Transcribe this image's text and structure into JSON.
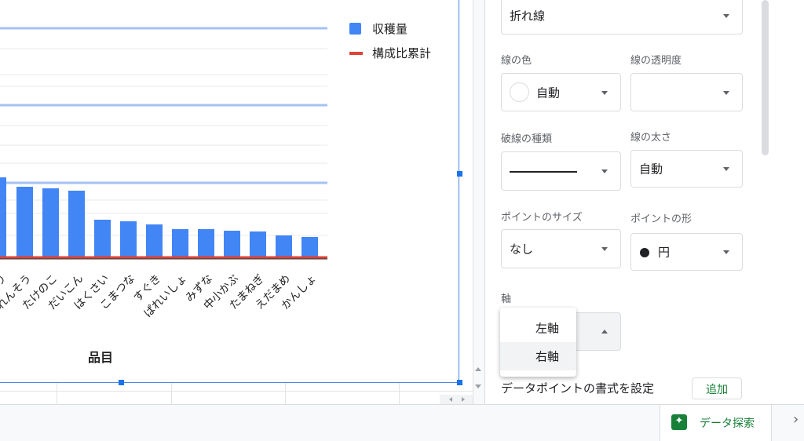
{
  "chart": {
    "legend": [
      {
        "label": "収穫量",
        "kind": "bar",
        "color": "#4285f4"
      },
      {
        "label": "構成比累計",
        "kind": "line",
        "color": "#db4437"
      }
    ],
    "xaxis_title": "品目"
  },
  "chart_data": {
    "type": "bar",
    "title": "",
    "xlabel": "品目",
    "ylabel": "",
    "categories": [
      "ほうれんそう",
      "たけのこ",
      "だいこん",
      "はくさい",
      "こまつな",
      "すぐき",
      "ぱれいしょ",
      "みずな",
      "中小かぶ",
      "たまねぎ",
      "えだまめ",
      "かんしょ"
    ],
    "series": [
      {
        "name": "収穫量",
        "values": [
          92,
          90,
          87,
          50,
          48,
          44,
          38,
          38,
          36,
          35,
          30,
          28
        ]
      }
    ],
    "partial_labels": [
      "り"
    ],
    "legend_position": "top-right"
  },
  "panel": {
    "chart_type_value": "折れ線",
    "line_color_label": "線の色",
    "line_color_value": "自動",
    "line_opacity_label": "線の透明度",
    "line_opacity_value": "",
    "dash_type_label": "破線の種類",
    "line_width_label": "線の太さ",
    "line_width_value": "自動",
    "point_size_label": "ポイントのサイズ",
    "point_size_value": "なし",
    "point_shape_label": "ポイントの形",
    "point_shape_value": "円",
    "axis_label": "軸",
    "axis_menu": [
      "左軸",
      "右軸"
    ],
    "datapoint_label": "データポイントの書式を設定",
    "add_button": "追加"
  },
  "bottom": {
    "explore_label": "データ探索",
    "explore_color": "#188038"
  }
}
